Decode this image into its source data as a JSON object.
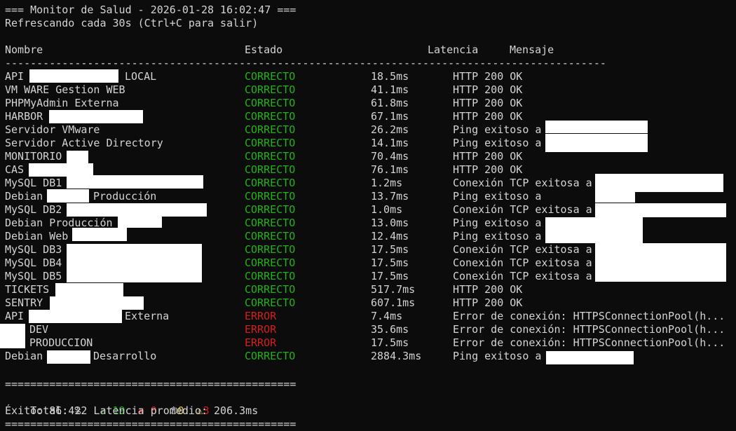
{
  "header": {
    "title_line": "=== Monitor de Salud - 2026-01-28 16:02:47 ===",
    "refresh_line": "Refrescando cada 30s (Ctrl+C para salir)"
  },
  "columns": {
    "name": "Nombre",
    "status": "Estado",
    "latency": "Latencia",
    "message": "Mensaje"
  },
  "separator_dash": "-------------------------------------------------------------------------------------------------------------------------",
  "rows": [
    {
      "name": "API",
      "name_suffix": "LOCAL",
      "status": "CORRECTO",
      "latency": "18.5ms",
      "message": "HTTP 200 OK"
    },
    {
      "name": "VM WARE Gestion WEB",
      "name_suffix": "",
      "status": "CORRECTO",
      "latency": "41.1ms",
      "message": "HTTP 200 OK"
    },
    {
      "name": "PHPMyAdmin Externa",
      "name_suffix": "",
      "status": "CORRECTO",
      "latency": "61.8ms",
      "message": "HTTP 200 OK"
    },
    {
      "name": "HARBOR",
      "name_suffix": "",
      "status": "CORRECTO",
      "latency": "67.1ms",
      "message": "HTTP 200 OK"
    },
    {
      "name": "Servidor VMware",
      "name_suffix": "",
      "status": "CORRECTO",
      "latency": "26.2ms",
      "message": "Ping exitoso a"
    },
    {
      "name": "Servidor Active Directory",
      "name_suffix": "",
      "status": "CORRECTO",
      "latency": "14.1ms",
      "message": "Ping exitoso a"
    },
    {
      "name": "MONITORIO",
      "name_suffix": "",
      "status": "CORRECTO",
      "latency": "70.4ms",
      "message": "HTTP 200 OK"
    },
    {
      "name": "CAS",
      "name_suffix": "",
      "status": "CORRECTO",
      "latency": "76.1ms",
      "message": "HTTP 200 OK"
    },
    {
      "name": "MySQL DB1",
      "name_suffix": "",
      "status": "CORRECTO",
      "latency": "1.2ms",
      "message": "Conexión TCP exitosa a"
    },
    {
      "name": "Debian",
      "name_suffix": "Producción",
      "status": "CORRECTO",
      "latency": "13.7ms",
      "message": "Ping exitoso a"
    },
    {
      "name": "MySQL DB2",
      "name_suffix": "",
      "status": "CORRECTO",
      "latency": "1.0ms",
      "message": "Conexión TCP exitosa a"
    },
    {
      "name": "Debian Producción",
      "name_suffix": "",
      "status": "CORRECTO",
      "latency": "13.0ms",
      "message": "Ping exitoso a"
    },
    {
      "name": "Debian Web",
      "name_suffix": "",
      "status": "CORRECTO",
      "latency": "12.4ms",
      "message": "Ping exitoso a"
    },
    {
      "name": "MySQL DB3",
      "name_suffix": "",
      "status": "CORRECTO",
      "latency": "17.5ms",
      "message": "Conexión TCP exitosa a"
    },
    {
      "name": "MySQL DB4",
      "name_suffix": "",
      "status": "CORRECTO",
      "latency": "17.5ms",
      "message": "Conexión TCP exitosa a"
    },
    {
      "name": "MySQL DB5",
      "name_suffix": "",
      "status": "CORRECTO",
      "latency": "17.5ms",
      "message": "Conexión TCP exitosa a"
    },
    {
      "name": "TICKETS",
      "name_suffix": "",
      "status": "CORRECTO",
      "latency": "517.7ms",
      "message": "HTTP 200 OK"
    },
    {
      "name": "SENTRY",
      "name_suffix": "",
      "status": "CORRECTO",
      "latency": "607.1ms",
      "message": "HTTP 200 OK"
    },
    {
      "name": "API",
      "name_suffix": "Externa",
      "status": "ERROR",
      "latency": "7.4ms",
      "message": "Error de conexión: HTTPSConnectionPool(h..."
    },
    {
      "name": "",
      "name_suffix": "DEV",
      "status": "ERROR",
      "latency": "35.6ms",
      "message": "Error de conexión: HTTPSConnectionPool(h..."
    },
    {
      "name": "",
      "name_suffix": "PRODUCCION",
      "status": "ERROR",
      "latency": "17.5ms",
      "message": "Error de conexión: HTTPSConnectionPool(h..."
    },
    {
      "name": "Debian",
      "name_suffix": "Desarrollo",
      "status": "CORRECTO",
      "latency": "2884.3ms",
      "message": "Ping exitoso a"
    }
  ],
  "separator_eq": "==============================================",
  "summary": {
    "total_label": "Total: 22",
    "ok_icon": "✓",
    "ok_count": "19",
    "err_icon": "✗",
    "err_count": "0",
    "timer_icon": "⏱",
    "timer_count": "0",
    "warn_icon": "⚠",
    "warn_count": "3",
    "success_line": "Éxito: 86.4%  Latencia promedio: 206.3ms"
  },
  "colors": {
    "background": "#0c0c0c",
    "text": "#d4d4d4",
    "ok": "#22b318",
    "error": "#d2201d",
    "warn": "#e7c03a"
  }
}
